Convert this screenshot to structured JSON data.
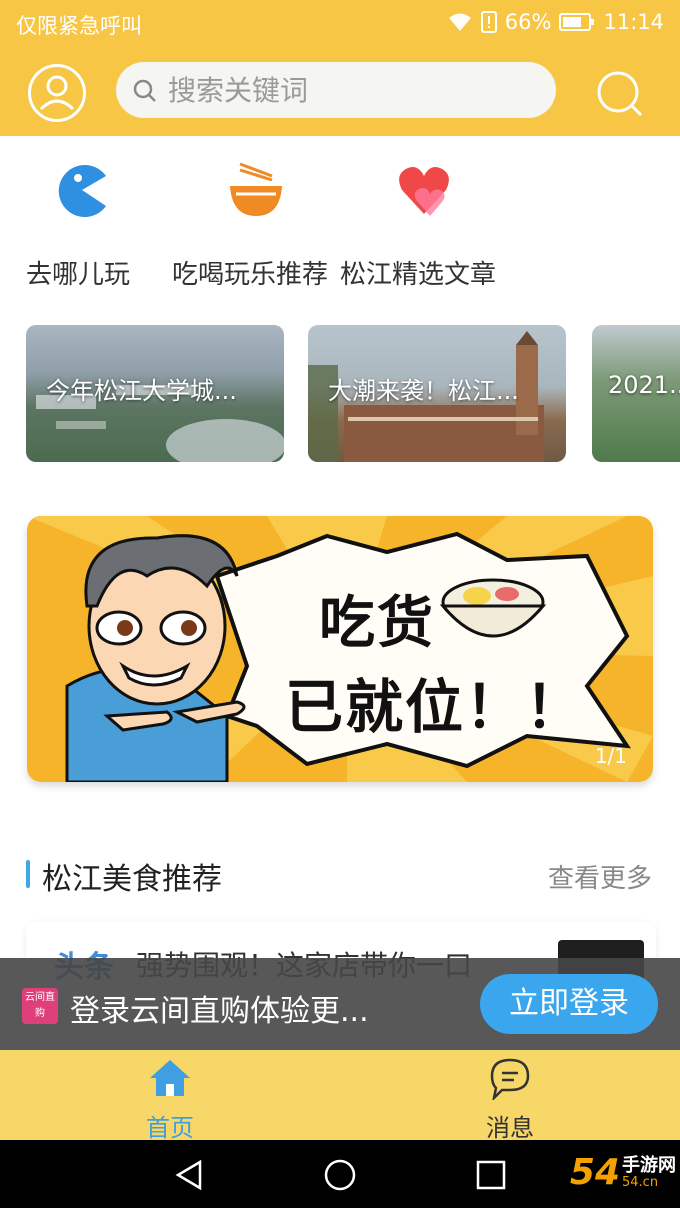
{
  "status_bar": {
    "carrier": "仅限紧急呼叫",
    "battery": "66%",
    "time": "11:14"
  },
  "header": {
    "search_placeholder": "搜索关键词"
  },
  "quick_nav": [
    {
      "label": "去哪儿玩",
      "icon": "pacman-icon",
      "color": "#2f8fe0"
    },
    {
      "label": "吃喝玩乐推荐",
      "icon": "bowl-icon",
      "color": "#f08a24"
    },
    {
      "label": "松江精选文章",
      "icon": "heart-icon",
      "color": "#f04848"
    }
  ],
  "carousel": [
    {
      "caption": "今年松江大学城..."
    },
    {
      "caption": "大潮来袭！松江..."
    },
    {
      "caption": "2021..."
    }
  ],
  "banner": {
    "line1": "吃货",
    "line2": "已就位！！",
    "page": "1/1"
  },
  "section": {
    "title": "松江美食推荐",
    "more": "查看更多"
  },
  "article": {
    "tag": "头条",
    "title": "强势围观！这家店带你一口"
  },
  "login_bar": {
    "badge": "云间直购",
    "text": "登录云间直购体验更...",
    "button": "立即登录"
  },
  "tabs": [
    {
      "label": "首页",
      "icon": "home-icon",
      "active": true
    },
    {
      "label": "消息",
      "icon": "chat-icon",
      "active": false
    }
  ],
  "watermark": {
    "number": "54",
    "text": "手游网",
    "sub": "54.cn"
  },
  "colors": {
    "header": "#f6c644",
    "tabbar": "#f6d768",
    "accent": "#3aa6ee",
    "active_tab": "#3f9fe0"
  }
}
